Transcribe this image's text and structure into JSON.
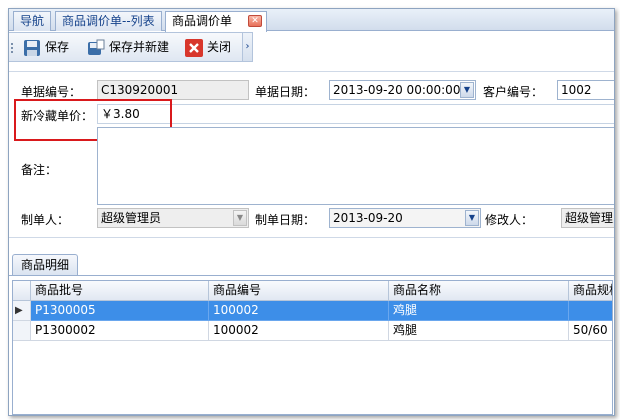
{
  "tabs": [
    {
      "label": "导航"
    },
    {
      "label": "商品调价单--列表"
    },
    {
      "label": "商品调价单"
    }
  ],
  "toolbar": {
    "save_label": "保存",
    "save_new_label": "保存并新建",
    "close_label": "关闭"
  },
  "form": {
    "doc_no_label": "单据编号：",
    "doc_no_value": "C130920001",
    "doc_date_label": "单据日期：",
    "doc_date_value": "2013-09-20  00:00:00",
    "customer_no_label": "客户编号：",
    "customer_no_value": "1002",
    "new_price_label": "新冷藏单价：",
    "new_price_value": "￥3.80",
    "remark_label": "备注：",
    "remark_value": "",
    "creator_label": "制单人：",
    "creator_value": "超级管理员",
    "create_date_label": "制单日期：",
    "create_date_value": "2013-09-20",
    "modifier_label": "修改人：",
    "modifier_value": "超级管理员"
  },
  "details_tab": {
    "label": "商品明细"
  },
  "grid": {
    "columns": [
      "商品批号",
      "商品编号",
      "商品名称",
      "商品规格"
    ],
    "rows": [
      {
        "selected": true,
        "cells": [
          "P1300005",
          "100002",
          "鸡腿",
          ""
        ]
      },
      {
        "selected": false,
        "cells": [
          "P1300002",
          "100002",
          "鸡腿",
          "50/60"
        ]
      }
    ]
  },
  "colors": {
    "accent": "#3d8ee8",
    "highlight": "#d9191c",
    "border": "#99afcf"
  }
}
